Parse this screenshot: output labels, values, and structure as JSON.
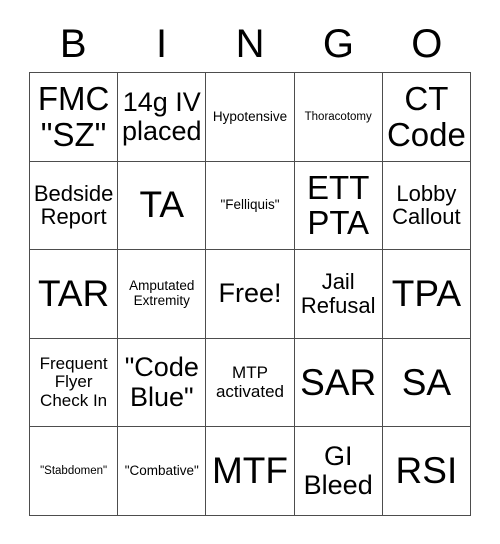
{
  "card": {
    "header_letters": [
      "B",
      "I",
      "N",
      "G",
      "O"
    ],
    "rows": [
      [
        {
          "text": "FMC\n\"SZ\"",
          "size": "lg"
        },
        {
          "text": "14g IV\nplaced",
          "size": "md"
        },
        {
          "text": "Hypotensive",
          "size": "xxs"
        },
        {
          "text": "Thoracotomy",
          "size": "tiny"
        },
        {
          "text": "CT\nCode",
          "size": "lg"
        }
      ],
      [
        {
          "text": "Bedside\nReport",
          "size": "sm"
        },
        {
          "text": "TA",
          "size": "xl"
        },
        {
          "text": "\"Felliquis\"",
          "size": "xxs"
        },
        {
          "text": "ETT\nPTA",
          "size": "lg"
        },
        {
          "text": "Lobby\nCallout",
          "size": "sm"
        }
      ],
      [
        {
          "text": "TAR",
          "size": "xl"
        },
        {
          "text": "Amputated\nExtremity",
          "size": "xxs"
        },
        {
          "text": "Free!",
          "size": "md"
        },
        {
          "text": "Jail\nRefusal",
          "size": "sm"
        },
        {
          "text": "TPA",
          "size": "xl"
        }
      ],
      [
        {
          "text": "Frequent\nFlyer\nCheck In",
          "size": "xs"
        },
        {
          "text": "\"Code\nBlue\"",
          "size": "md"
        },
        {
          "text": "MTP\nactivated",
          "size": "xs"
        },
        {
          "text": "SAR",
          "size": "xl"
        },
        {
          "text": "SA",
          "size": "xl"
        }
      ],
      [
        {
          "text": "\"Stabdomen\"",
          "size": "tiny"
        },
        {
          "text": "\"Combative\"",
          "size": "xxs"
        },
        {
          "text": "MTF",
          "size": "xl"
        },
        {
          "text": "GI\nBleed",
          "size": "md"
        },
        {
          "text": "RSI",
          "size": "xl"
        }
      ]
    ]
  },
  "colors": {
    "background": "#ffffff",
    "text": "#000000",
    "grid_line": "#4d4d4d"
  }
}
